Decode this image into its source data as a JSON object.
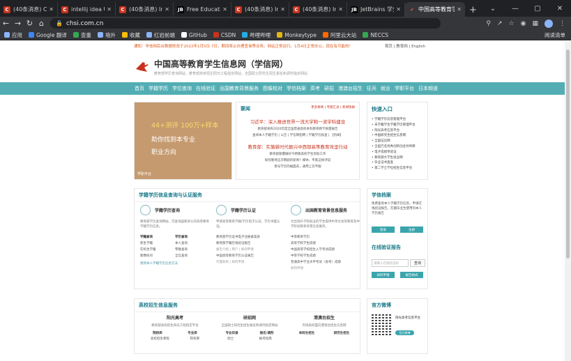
{
  "browser": {
    "tabs": [
      {
        "label": "(40条消息) CS",
        "icon": "csdn-icon"
      },
      {
        "label": "intellij idea U",
        "icon": "csdn-icon"
      },
      {
        "label": "(40条消息) Int",
        "icon": "csdn-icon"
      },
      {
        "label": "Free Educatio",
        "icon": "jetbrains-icon"
      },
      {
        "label": "(40条消息) Int",
        "icon": "csdn-icon"
      },
      {
        "label": "(40条消息) Int",
        "icon": "csdn-icon"
      },
      {
        "label": "JetBrains 学生",
        "icon": "jetbrains-icon"
      },
      {
        "label": "中国高等教育学",
        "icon": "chsi-icon"
      }
    ],
    "new_tab": "+",
    "url": "chsi.com.cn",
    "bookmarks": [
      {
        "label": "应用",
        "color": "#8ab4f8"
      },
      {
        "label": "Google 翻译",
        "color": "#4285f4"
      },
      {
        "label": "查重",
        "color": "#34a853"
      },
      {
        "label": "墙外",
        "color": "#8ab4f8"
      },
      {
        "label": "收藏",
        "color": "#fbbc04"
      },
      {
        "label": "红岩前端",
        "color": "#8ab4f8"
      },
      {
        "label": "GitHub",
        "color": "#ffffff"
      },
      {
        "label": "CSDN",
        "color": "#c8321e"
      },
      {
        "label": "哔哩哔哩",
        "color": "#23ade5"
      },
      {
        "label": "Monkeytype",
        "color": "#e2b714"
      },
      {
        "label": "阿里云大站",
        "color": "#ff6a00"
      },
      {
        "label": "NECCS",
        "color": "#34a853"
      }
    ],
    "reading_list": "阅读清单"
  },
  "site": {
    "notice": "通知：学信网后台数据修改于2022年1月5日-7日，期间将止办理查询等业务。网站正常运行。1月4日正常办公。现在有可能的！",
    "notice_right": "首页 | 教育网 | English",
    "logo_cn": "中国高等教育学生信息网（学信网）",
    "logo_sub": "教育部学历查询网站、教育部高校招生阳光工程指定网站、全国硕士研究生招生报名和调剂指定网站",
    "logo_abbr": "CHSI",
    "nav": [
      "首页",
      "学籍学历",
      "学位查询",
      "在线验证",
      "出国教育背景服务",
      "图像校对",
      "学信档案",
      "高考",
      "研招",
      "港澳台招生",
      "征兵",
      "就业",
      "学职平台",
      "日本频道"
    ],
    "hero": {
      "title": "44+测评 100万+样本",
      "line1": "助你找到本专业",
      "line2": "职业方向",
      "tag": "学职平台"
    },
    "news": {
      "head": "要闻",
      "right": "更多要闻 | 专题汇总 | 新闻快报",
      "big1": "习近平：深入推进世界一流大学和一流学科建设",
      "lines1": [
        "教育部发布2020年度全国普通高校本科教育教学质量报告",
        "查阅本人学籍学历 | 公告 | 学信网招聘 | 学籍学历核查 | 【热闻】"
      ],
      "big2": "教育部：实施新时代振兴中西部高等教育攻坚行动",
      "lines2": [
        "教育部部署做好今明春高校学生资助工作",
        "如何看待这次网剧的新奇？媒体、专家这样评说",
        "善号学历的幅面去，通用上云平服"
      ]
    },
    "quick": {
      "head": "快速入口",
      "items": [
        "学籍学历信息管理平台",
        "未学籍学生学籍学历管理平台",
        "阳光高考信息平台",
        "中国研究生招生信息网",
        "全国征兵网",
        "全国万名优秀创新创业导师库",
        "电子成绩单验证",
        "教育部大学生就业网",
        "毕业证书直查",
        "第二学士学位招生信息平台"
      ]
    },
    "query": {
      "head": "学籍学历信息查询与认证服务",
      "c1": {
        "title": "学籍学历查询",
        "desc": "教育部学历查询网站，可查询国家承认的高等教育学籍学历信息。",
        "grid": [
          "学籍查询",
          "学历查询",
          "新生学籍",
          "本人查询",
          "在校生学籍",
          "零散查询",
          "图像校对",
          "全信查询"
        ],
        "link": "更新本人学籍学历信息方法"
      },
      "c2": {
        "title": "学籍学历认证",
        "desc": "申请高等教育学籍/学历电子认证、学历书面认证。",
        "list": [
          "教育部学历证书电子注册备案表",
          "教育部学籍在线验证报告",
          "报告介绍 | 用户 | 如何申请",
          "中国高等教育学历认证报告",
          "代理机构 | 如何申请"
        ]
      },
      "c3": {
        "title": "出国教育背景信息服务",
        "desc": "为出境升学和就业的学生提供中英文高等教育及中学阶段教育背景信息服务。",
        "list": [
          "中等教育学历",
          "高等学校学生成绩",
          "中国高等学校招生入学考试成绩",
          "中等学校学生成绩",
          "普通高中学业水平考试（会考）成绩",
          "如何申请"
        ]
      }
    },
    "archive": {
      "head": "学信档案",
      "text": "免费查询本人学籍学历信息，申请在线验证报告，在籍毕业生使用的本人学历报告",
      "login": "登录",
      "register": "注册",
      "verify_head": "在线验证报告",
      "verify_placeholder": "请输入在线验证码",
      "verify_btn": "查询",
      "apply": "如何申请",
      "more": "报告格式"
    },
    "admissions": {
      "head": "高校招生信息服务",
      "cols": [
        {
          "title": "阳光高考",
          "desc": "教育部高校招生阳光工程指定平台",
          "g": [
            "院校库",
            "专业库"
          ],
          "g2": [
            "高校招生章程",
            "院校库"
          ]
        },
        {
          "title": "研招网",
          "desc": "全国硕士研究生招生报名和调剂指定网站",
          "g": [
            "专业目录",
            "报名/调剂"
          ],
          "g2": [
            "硕士",
            "报考指南"
          ]
        },
        {
          "title": "港澳台招生",
          "desc": "内地高校面向港澳台招生信息网",
          "g": [
            "本科生招生",
            "研究生招生"
          ],
          "g2": [
            "",
            ""
          ]
        }
      ]
    },
    "weibo": {
      "head": "官方微博",
      "text": "阳光高考信息平台",
      "btn": "官方微博"
    }
  }
}
